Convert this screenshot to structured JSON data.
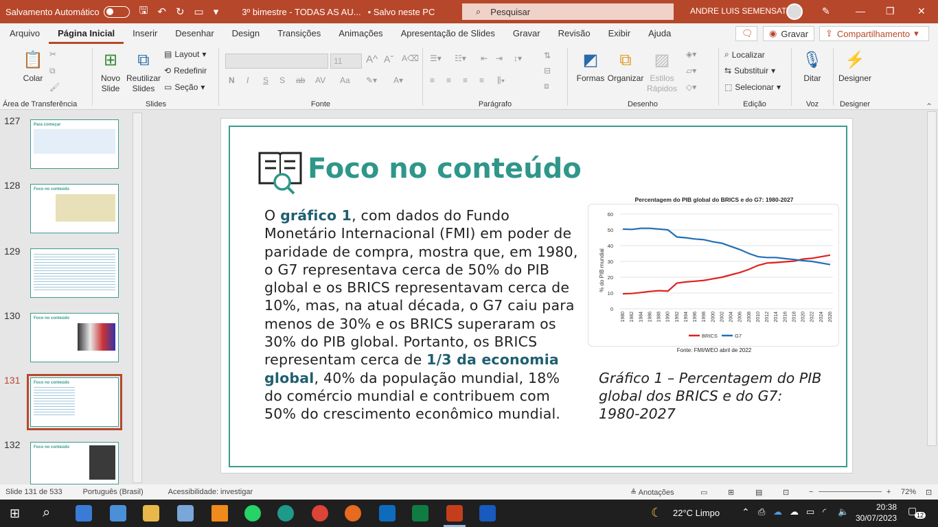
{
  "titlebar": {
    "autosave": "Salvamento Automático",
    "filename": "3º bimestre - TODAS AS AU...",
    "save_status": "• Salvo neste PC",
    "search_placeholder": "Pesquisar",
    "user": "ANDRE LUIS SEMENSATO"
  },
  "tabs": [
    "Arquivo",
    "Página Inicial",
    "Inserir",
    "Desenhar",
    "Design",
    "Transições",
    "Animações",
    "Apresentação de Slides",
    "Gravar",
    "Revisão",
    "Exibir",
    "Ajuda"
  ],
  "tab_right": {
    "record": "Gravar",
    "share": "Compartilhamento"
  },
  "ribbon": {
    "clipboard": {
      "label": "Área de Transferência",
      "paste": "Colar"
    },
    "slides": {
      "label": "Slides",
      "new_slide": "Novo Slide",
      "reuse": "Reutilizar Slides",
      "layout": "Layout",
      "reset": "Redefinir",
      "section": "Seção"
    },
    "font": {
      "label": "Fonte",
      "size": "11"
    },
    "paragraph": {
      "label": "Parágrafo"
    },
    "drawing": {
      "label": "Desenho",
      "shapes": "Formas",
      "arrange": "Organizar",
      "quick_styles": "Estilos Rápidos"
    },
    "editing": {
      "label": "Edição",
      "find": "Localizar",
      "replace": "Substituir",
      "select": "Selecionar"
    },
    "voice": {
      "label": "Voz",
      "dictate": "Ditar"
    },
    "designer": {
      "label": "Designer",
      "btn": "Designer"
    }
  },
  "thumbnails": [
    {
      "num": "127",
      "title": "Para começar"
    },
    {
      "num": "128",
      "title": "Foco no conteúdo"
    },
    {
      "num": "129",
      "title": ""
    },
    {
      "num": "130",
      "title": "Foco no conteúdo"
    },
    {
      "num": "131",
      "title": "Foco no conteúdo"
    },
    {
      "num": "132",
      "title": "Foco no conteúdo"
    }
  ],
  "slide": {
    "title": "Foco no conteúdo",
    "body": {
      "p1": "O ",
      "b1": "gráfico 1",
      "p2": ", com dados do Fundo Monetário Internacional (FMI) em poder de paridade de compra, mostra que, em 1980, o G7 representava cerca de 50% do PIB global e os BRICS representavam cerca de 10%, mas, na atual década, o G7 caiu para menos de 30% e os BRICS superaram os 30% do PIB global. Portanto, os BRICS representam cerca de ",
      "b2": "1/3 da economia global",
      "p3": ", 40% da população mundial, 18% do comércio mundial e contribuem com 50% do crescimento econômico mundial."
    },
    "caption": "Gráfico 1 – Percentagem do PIB global dos BRICS e do G7: 1980-2027"
  },
  "chart_data": {
    "type": "line",
    "title": "Percentagem do PIB global do BRICS e do G7: 1980-2027",
    "ylabel": "% do PIB mundial",
    "xlabel": "",
    "source": "Fonte: FMI/WEO abril de 2022",
    "ylim": [
      0,
      60
    ],
    "yticks": [
      "0",
      "10",
      "20",
      "30",
      "40",
      "50",
      "60"
    ],
    "x": [
      "1980",
      "1982",
      "1984",
      "1986",
      "1988",
      "1990",
      "1992",
      "1994",
      "1996",
      "1998",
      "2000",
      "2002",
      "2004",
      "2006",
      "2008",
      "2010",
      "2012",
      "2014",
      "2016",
      "2018",
      "2020",
      "2022",
      "2024",
      "2026"
    ],
    "series": [
      {
        "name": "BRICS",
        "color": "#e02020",
        "values": [
          9.5,
          9.7,
          10.3,
          11,
          11.5,
          11.2,
          16.3,
          17,
          17.5,
          18,
          19,
          20,
          21.5,
          23,
          25,
          27.5,
          29,
          29.3,
          29.8,
          30.2,
          31.5,
          32,
          33,
          34
        ]
      },
      {
        "name": "G7",
        "color": "#1f6fb5",
        "values": [
          50.5,
          50.3,
          51,
          51,
          50.5,
          50,
          45.5,
          45,
          44.2,
          43.8,
          42.5,
          41.5,
          39.5,
          37.5,
          35,
          33,
          32.5,
          32.5,
          31.8,
          31.2,
          30.5,
          30,
          29,
          28
        ]
      }
    ]
  },
  "status": {
    "slide": "Slide 131 de 533",
    "language": "Português (Brasil)",
    "accessibility": "Acessibilidade: investigar",
    "notes": "Anotações",
    "zoom": "72%"
  },
  "taskbar": {
    "weather": "22°C  Limpo",
    "time": "20:38",
    "date": "30/07/2023",
    "badge": "12"
  }
}
